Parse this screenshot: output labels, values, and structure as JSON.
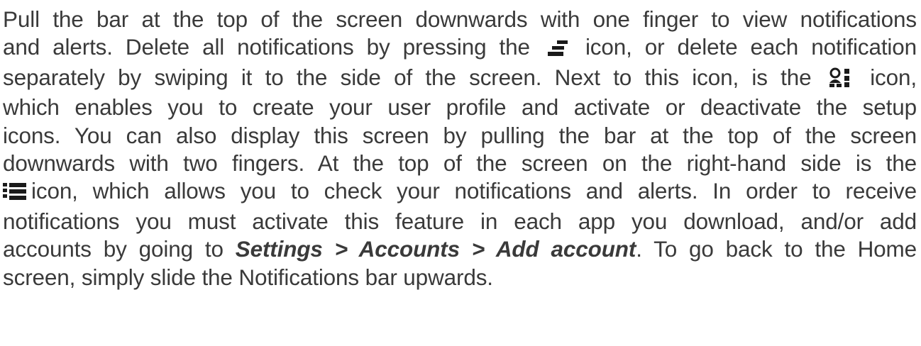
{
  "paragraph": {
    "l1": "Pull the bar at the top of the screen downwards with one finger to view notifications",
    "l2a": "and alerts. Delete all notifications by pressing the",
    "l2b": "icon, or delete each notification",
    "l3a": "separately by swiping it to the side of the screen. Next to this icon, is the",
    "l3b": "icon,",
    "l4": "which enables you to create your user profile and activate or deactivate the setup",
    "l5": "icons. You can also display this screen by pulling the bar at the top of the screen",
    "l6": "downwards with two fingers. At the top of the screen on the right-hand side is the",
    "l7b": "icon, which allows you to check your notifications and alerts. In order to receive",
    "l8": "notifications you must activate this feature in each app you download, and/or add",
    "l9a": "accounts by going to",
    "l9_settings_path": "Settings > Accounts > Add account",
    "l9b": ". To go back to the Home",
    "l10": "screen, simply slide the Notifications bar upwards."
  },
  "icons": {
    "clear": "clear-all-notifications-icon",
    "profile": "user-profile-settings-icon",
    "notifications": "notifications-list-icon"
  },
  "colors": {
    "text": "#3a3a3a",
    "icon": "#1a1a1a"
  }
}
